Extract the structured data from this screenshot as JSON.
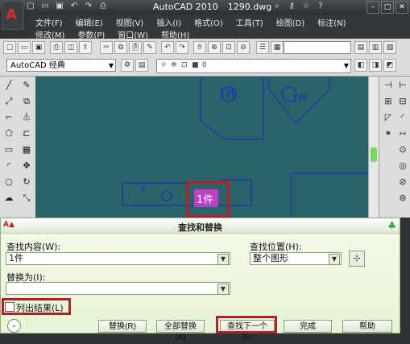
{
  "window": {
    "app_title": "AutoCAD 2010",
    "file_name": "1290.dwg"
  },
  "menu": {
    "row1": [
      "文件(F)",
      "编辑(E)",
      "视图(V)",
      "插入(I)",
      "格式(O)",
      "工具(T)",
      "绘图(D)",
      "标注(N)"
    ],
    "row2": [
      "修改(M)",
      "参数(P)",
      "窗口(W)",
      "帮助(H)"
    ]
  },
  "toolbar": {
    "workspace": "AutoCAD 经典",
    "layer": "0"
  },
  "drawing": {
    "labels": [
      "1件",
      "1件",
      "1件"
    ],
    "background": "#2b6468",
    "line_color": "#1f2fbf",
    "highlight_fill": "#d63ad6"
  },
  "dialog": {
    "title": "查找和替换",
    "find_label": "查找内容(W):",
    "find_value": "1件",
    "search_in_label": "查找位置(H):",
    "search_in_value": "整个图形",
    "replace_label": "替换为(I):",
    "replace_value": "",
    "list_results_label": "列出结果(L)",
    "buttons": {
      "replace": "替换(R)",
      "replace_all": "全部替换(A)",
      "find_next": "查找下一个(F)",
      "done": "完成",
      "help": "帮助"
    }
  },
  "colors": {
    "highlight": "#b3202a",
    "dialog_bg": "#eef7e2"
  }
}
